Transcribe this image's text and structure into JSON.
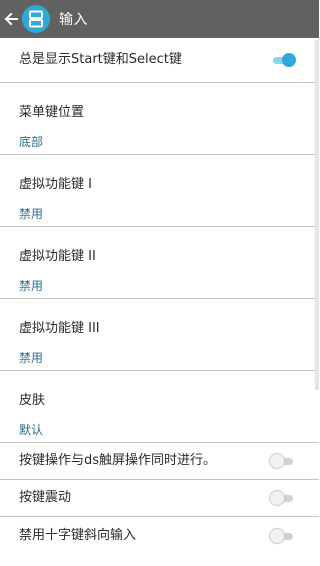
{
  "toolbar": {
    "title": "输入",
    "back_icon": "arrow-left-icon",
    "logo_icon": "ds-logo-icon"
  },
  "settings": {
    "show_start_select": {
      "label": "总是显示Start键和Select键",
      "enabled": true
    },
    "menu_key_position": {
      "label": "菜单键位置",
      "value": "底部"
    },
    "virtual_key_1": {
      "label": "虚拟功能键 I",
      "value": "禁用"
    },
    "virtual_key_2": {
      "label": "虚拟功能键 II",
      "value": "禁用"
    },
    "virtual_key_3": {
      "label": "虚拟功能键 III",
      "value": "禁用"
    },
    "skin": {
      "label": "皮肤",
      "value": "默认"
    },
    "simultaneous_touch": {
      "label": "按键操作与ds触屏操作同时进行。",
      "enabled": false
    },
    "key_vibration": {
      "label": "按键震动",
      "enabled": false
    },
    "disable_diagonal": {
      "label": "禁用十字键斜向输入",
      "enabled": false
    }
  },
  "colors": {
    "toolbar_bg": "#616161",
    "accent": "#2ea9d8",
    "value_text": "#2b6f8c",
    "divider": "#c4c4c4"
  }
}
